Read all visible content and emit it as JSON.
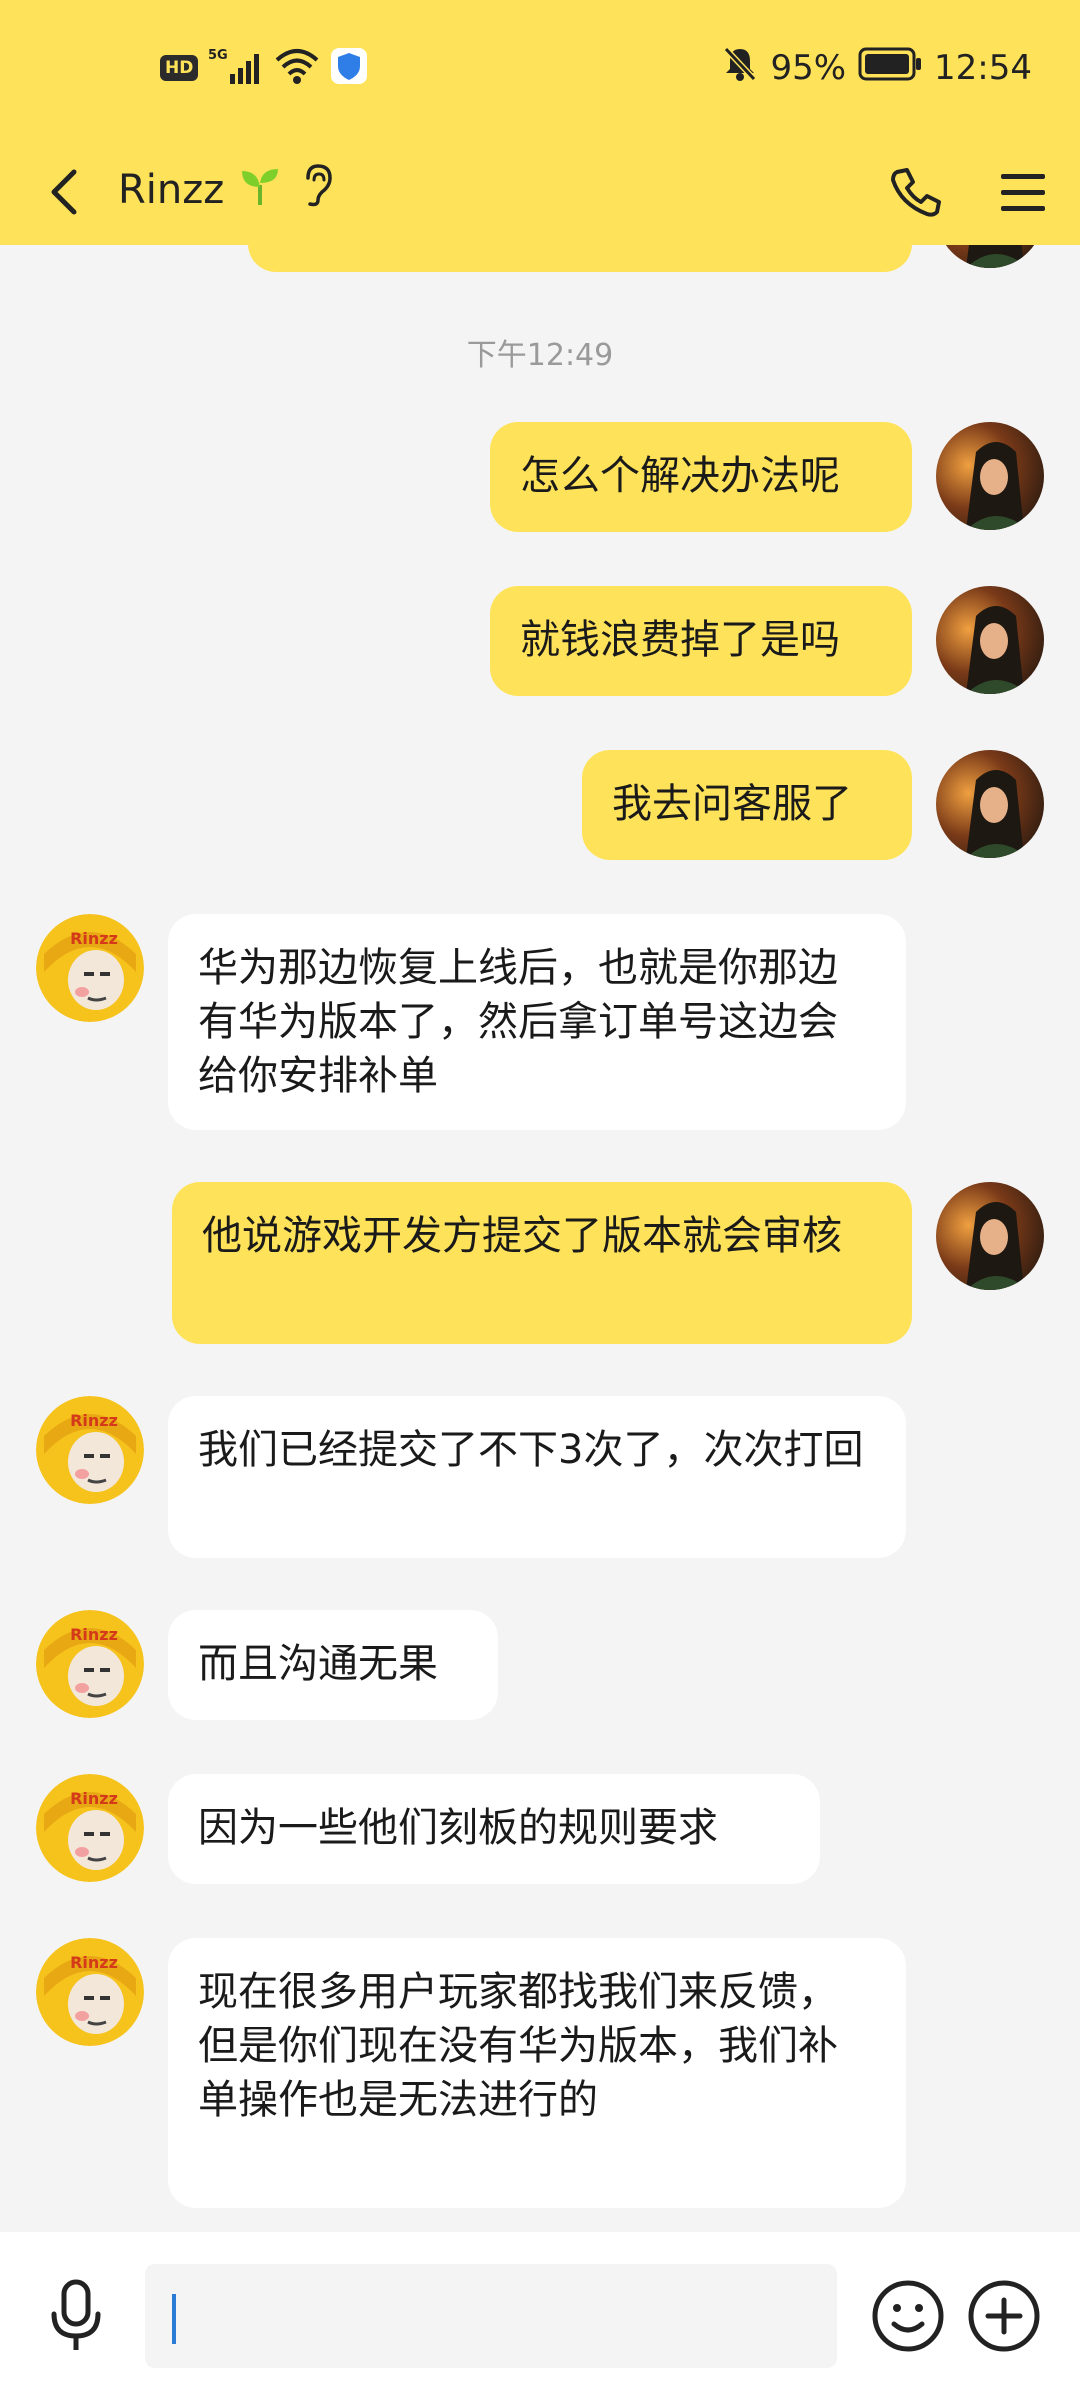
{
  "status_bar": {
    "hd": "HD",
    "network": "5G",
    "battery": "95%",
    "time": "12:54"
  },
  "header": {
    "contact_name": "Rinzz",
    "sprout_icon": "sprout-icon",
    "ear_icon": "ear-icon",
    "back_icon": "back-arrow-icon",
    "call_icon": "phone-icon",
    "menu_icon": "menu-icon"
  },
  "chat": {
    "timestamp": "下午12:49",
    "messages": [
      {
        "from": "me",
        "text": "怎么个解决办法呢"
      },
      {
        "from": "me",
        "text": "就钱浪费掉了是吗"
      },
      {
        "from": "me",
        "text": "我去问客服了"
      },
      {
        "from": "them",
        "text": "华为那边恢复上线后，也就是你那边有华为版本了，然后拿订单号这边会给你安排补单"
      },
      {
        "from": "me",
        "text": "他说游戏开发方提交了版本就会审核"
      },
      {
        "from": "them",
        "text": "我们已经提交了不下3次了，次次打回"
      },
      {
        "from": "them",
        "text": "而且沟通无果"
      },
      {
        "from": "them",
        "text": "因为一些他们刻板的规则要求"
      },
      {
        "from": "them",
        "text": "现在很多用户玩家都找我们来反馈，但是你们现在没有华为版本，我们补单操作也是无法进行的"
      }
    ],
    "them_logo_text": "Rinzz"
  },
  "input_bar": {
    "placeholder": "",
    "value": ""
  },
  "colors": {
    "accent_yellow": "#fee35a",
    "background": "#f4f4f4",
    "incoming_bubble": "#ffffff",
    "caret": "#2a7bd6"
  }
}
